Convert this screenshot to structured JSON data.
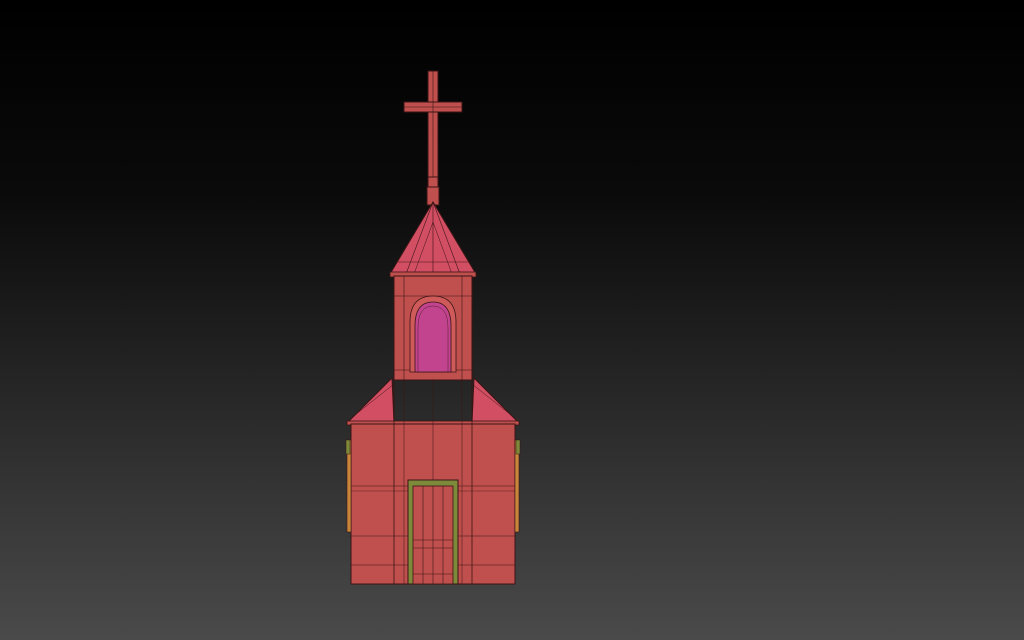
{
  "viewport": {
    "background_top": "#000000",
    "background_bottom": "#4a4a4a"
  },
  "model": {
    "name": "church",
    "parts": [
      "cross",
      "spire",
      "bell-tower",
      "arch-window",
      "main-roof",
      "walls",
      "door",
      "side-windows"
    ],
    "colors": {
      "body": "#c0504d",
      "body_light": "#cf5a5a",
      "roof": "#d24e63",
      "window_glass": "#c2448f",
      "wire": "#3a1515",
      "door_frame": "#7d8a3a",
      "side_trim": "#c9863b"
    }
  }
}
